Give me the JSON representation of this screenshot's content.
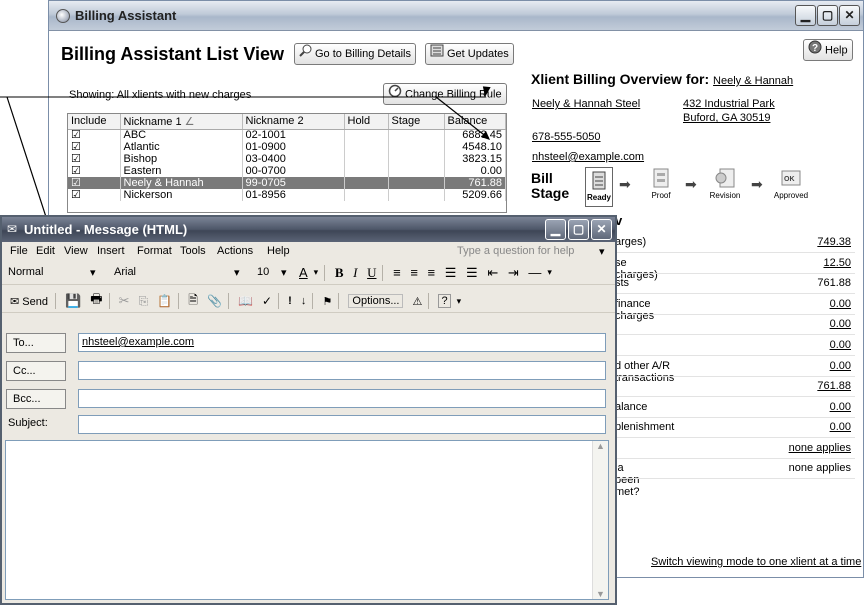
{
  "billing": {
    "window_title": "Billing Assistant",
    "heading": "Billing Assistant List View",
    "go_details_label": "Go to Billing Details",
    "updates_label": "Get Updates",
    "help_label": "Help",
    "showing": "Showing:  All xlients with new charges",
    "change_rule_label": "Change Billing Rule",
    "columns": [
      "Include",
      "Nickname 1",
      "Nickname 2",
      "Hold",
      "Stage",
      "Balance"
    ],
    "sort_indicator": "∠",
    "rows": [
      {
        "include": "☑",
        "nick1": "ABC",
        "nick2": "02-1001",
        "hold": "",
        "stage": "",
        "balance": "6883.45"
      },
      {
        "include": "☑",
        "nick1": "Atlantic",
        "nick2": "01-0900",
        "hold": "",
        "stage": "",
        "balance": "4548.10"
      },
      {
        "include": "☑",
        "nick1": "Bishop",
        "nick2": "03-0400",
        "hold": "",
        "stage": "",
        "balance": "3823.15"
      },
      {
        "include": "☑",
        "nick1": "Eastern",
        "nick2": "00-0700",
        "hold": "",
        "stage": "",
        "balance": "0.00"
      },
      {
        "include": "☑",
        "nick1": "Neely & Hannah",
        "nick2": "99-0705",
        "hold": "",
        "stage": "",
        "balance": "761.88"
      },
      {
        "include": "☑",
        "nick1": "Nickerson",
        "nick2": "01-8956",
        "hold": "",
        "stage": "",
        "balance": "5209.66"
      }
    ],
    "overview_title": "Xlient Billing Overview for:",
    "overview_client": "Neely & Hannah",
    "client_name": "Neely & Hannah Steel",
    "address1": "432 Industrial Park",
    "address2": "Buford, GA 30519",
    "phone": "678-555-5050",
    "email": "nhsteel@example.com",
    "bill_stage_label_1": "Bill",
    "bill_stage_label_2": "Stage",
    "stages": [
      "Ready",
      "Proof",
      "Revision",
      "Approved"
    ],
    "summary_rows": [
      {
        "label": "arges)",
        "value": "749.38",
        "link": true
      },
      {
        "label": "se charges)",
        "value": "12.50",
        "link": true
      },
      {
        "label": "sts",
        "value": "761.88",
        "link": false
      },
      {
        "label": "finance charges",
        "value": "0.00",
        "link": true
      },
      {
        "label": "",
        "value": "0.00",
        "link": true
      },
      {
        "label": "",
        "value": "0.00",
        "link": true
      },
      {
        "label": "d other A/R transactions",
        "value": "0.00",
        "link": true
      },
      {
        "label": "",
        "value": "761.88",
        "link": true
      },
      {
        "label": "alance",
        "value": "0.00",
        "link": true
      },
      {
        "label": "plenishment",
        "value": "0.00",
        "link": true
      },
      {
        "label": "",
        "value": "none applies",
        "link": true
      },
      {
        "label": "ia been met?",
        "value": "none applies",
        "link": false
      }
    ],
    "section_fragment": "v",
    "switch_mode": "Switch viewing mode to one xlient at a time"
  },
  "message": {
    "window_title": "Untitled - Message (HTML)",
    "menus": [
      "File",
      "Edit",
      "View",
      "Insert",
      "Format",
      "Tools",
      "Actions",
      "Help"
    ],
    "help_placeholder": "Type a question for help",
    "style_value": "Normal",
    "font_value": "Arial",
    "size_value": "10",
    "send_label": "Send",
    "options_label": "Options...",
    "to_label": "To...",
    "to_value": "nhsteel@example.com",
    "cc_label": "Cc...",
    "cc_value": "",
    "bcc_label": "Bcc...",
    "bcc_value": "",
    "subject_label": "Subject:",
    "subject_value": "",
    "body_value": ""
  }
}
